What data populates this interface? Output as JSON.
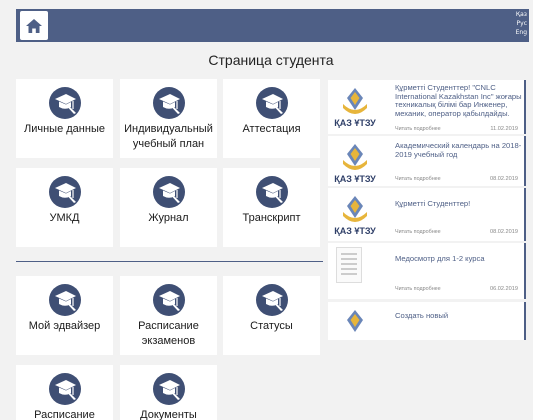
{
  "header": {
    "languages": [
      "Қаз",
      "Рус",
      "Eng"
    ]
  },
  "page_title": "Страница студента",
  "tiles": [
    {
      "label": "Личные данные"
    },
    {
      "label": "Индивидуальный учебный план"
    },
    {
      "label": "Аттестация"
    },
    {
      "label": "УМКД"
    },
    {
      "label": "Журнал"
    },
    {
      "label": "Транскрипт"
    },
    {
      "label": "Мой эдвайзер"
    },
    {
      "label": "Расписание экзаменов"
    },
    {
      "label": "Статусы"
    },
    {
      "label": "Расписание"
    },
    {
      "label": "Документы"
    }
  ],
  "news": [
    {
      "title": "Құрметті Студенттер! \"CNLC International Kazakhstan Inc\" жоғары техникалық білімі бар Инженер, механик, оператор қабылдайды.",
      "more": "Читать подробнее",
      "date": "11.02.2019",
      "thumb_text": "ҚАЗ ҰТЗУ"
    },
    {
      "title": "Академический календарь на 2018-2019 учебный год",
      "more": "Читать подробнее",
      "date": "08.02.2019",
      "thumb_text": "ҚАЗ ҰТЗУ"
    },
    {
      "title": "Құрметті Студенттер!",
      "more": "Читать подробнее",
      "date": "08.02.2019",
      "thumb_text": "ҚАЗ ҰТЗУ"
    },
    {
      "title": "Медосмотр для 1-2 курса",
      "more": "Читать подробнее",
      "date": "06.02.2019",
      "thumb_text": ""
    },
    {
      "title": "Создать новый",
      "more": "",
      "date": "",
      "thumb_text": ""
    }
  ],
  "colors": {
    "accent": "#4e5f86",
    "icon": "#3f4f74",
    "background": "#f2f2f2"
  },
  "icons": {
    "home": "home-icon",
    "tile": "graduation-cap-pen-icon",
    "news": "university-logo"
  }
}
